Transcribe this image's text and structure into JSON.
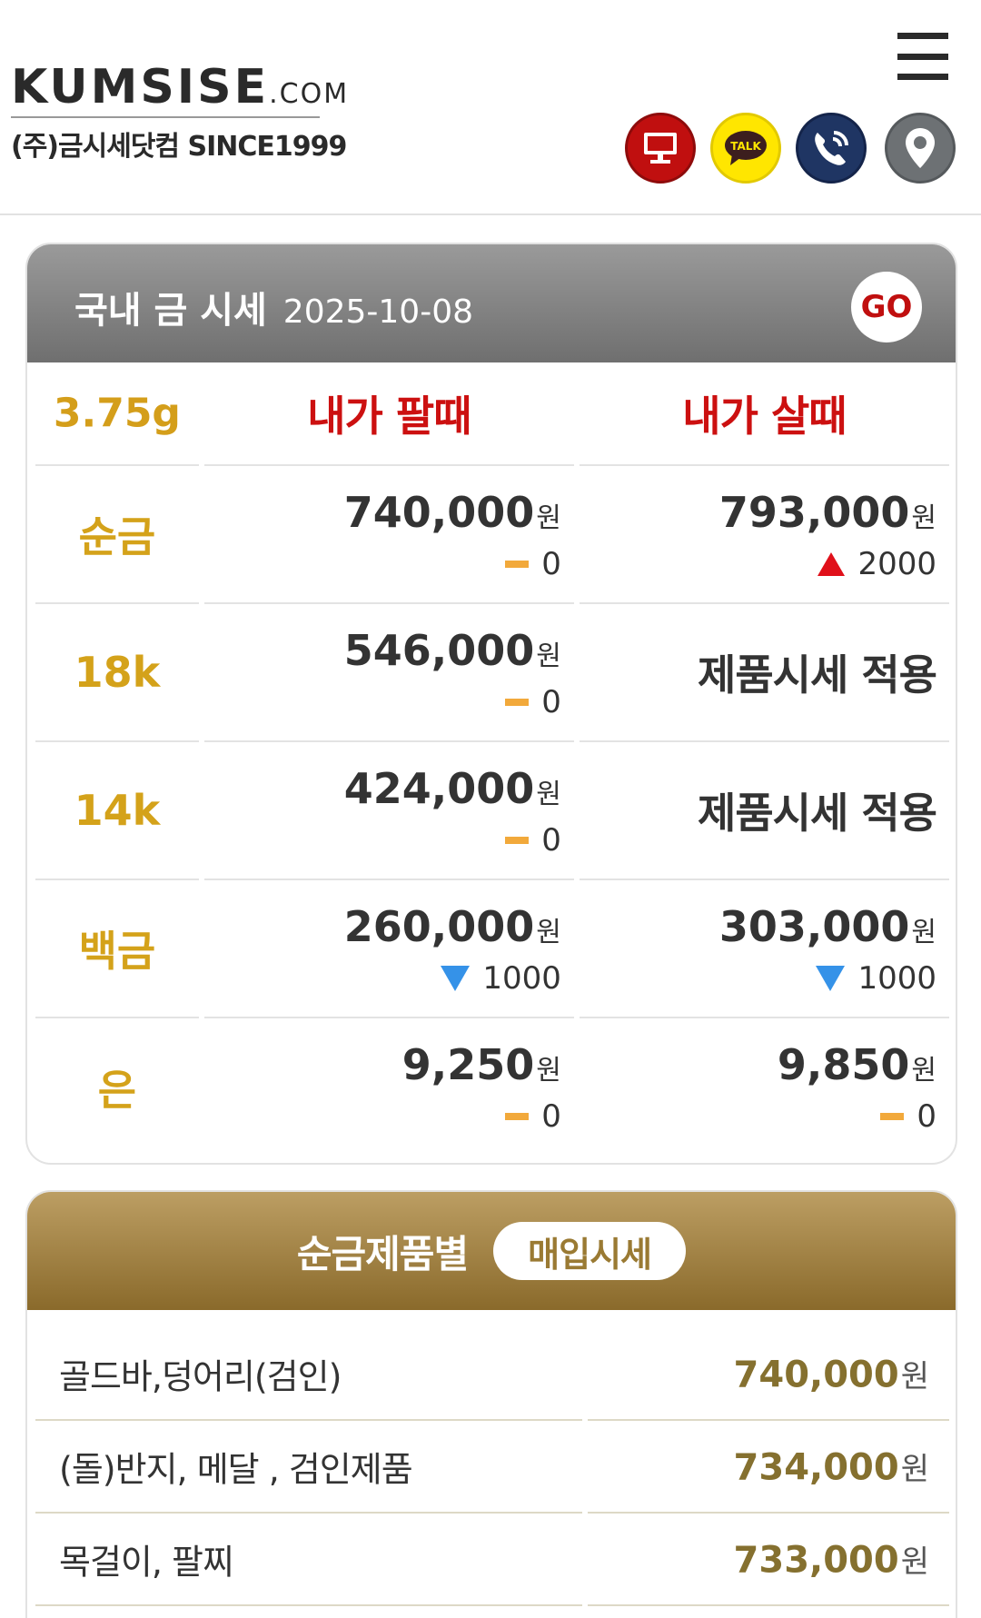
{
  "header": {
    "logo_main": "KUMSISE",
    "logo_com": ".COM",
    "logo_sub": "(주)금시세닷컴 SINCE1999",
    "icons": [
      "monitor-icon",
      "kakao-talk-icon",
      "phone-icon",
      "map-pin-icon"
    ],
    "talk_label": "TALK"
  },
  "gold_card": {
    "title": "국내 금 시세",
    "date": "2025-10-08",
    "go_label": "GO",
    "unit_label": "3.75g",
    "sell_header": "내가 팔때",
    "buy_header": "내가 살때",
    "currency": "원",
    "rows": [
      {
        "label": "순금",
        "sell_price": "740,000",
        "sell_change": "0",
        "sell_dir": "flat",
        "buy_price": "793,000",
        "buy_change": "2000",
        "buy_dir": "up"
      },
      {
        "label": "18k",
        "sell_price": "546,000",
        "sell_change": "0",
        "sell_dir": "flat",
        "buy_text": "제품시세 적용"
      },
      {
        "label": "14k",
        "sell_price": "424,000",
        "sell_change": "0",
        "sell_dir": "flat",
        "buy_text": "제품시세 적용"
      },
      {
        "label": "백금",
        "sell_price": "260,000",
        "sell_change": "1000",
        "sell_dir": "down",
        "buy_price": "303,000",
        "buy_change": "1000",
        "buy_dir": "down"
      },
      {
        "label": "은",
        "sell_price": "9,250",
        "sell_change": "0",
        "sell_dir": "flat",
        "buy_price": "9,850",
        "buy_change": "0",
        "buy_dir": "flat"
      }
    ],
    "colors": {
      "up": "#e0101a",
      "down": "#3592e8",
      "flat": "#f2a93b",
      "label": "#d4a21a",
      "header_red": "#cc1010"
    }
  },
  "product_card": {
    "title": "순금제품별",
    "pill": "매입시세",
    "currency": "원",
    "items": [
      {
        "name": "골드바,덩어리(검인)",
        "price": "740,000"
      },
      {
        "name": "(돌)반지, 메달 , 검인제품",
        "price": "734,000"
      },
      {
        "name": "목걸이, 팔찌",
        "price": "733,000"
      }
    ]
  }
}
